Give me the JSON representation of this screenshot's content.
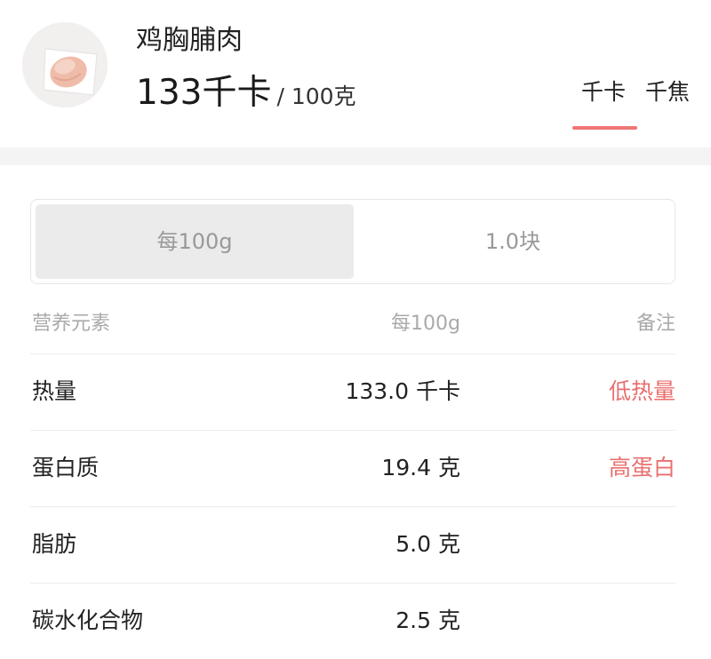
{
  "food": {
    "name": "鸡胸脯肉",
    "calories_value": "133",
    "calories_unit": "千卡",
    "per_unit": "/ 100克",
    "image_icon": "chicken-breast-photo"
  },
  "unit_tabs": {
    "items": [
      "千卡",
      "千焦"
    ],
    "active_index": 0,
    "accent_color": "#f07676"
  },
  "portion_selector": {
    "options": [
      "每100g",
      "1.0块"
    ],
    "active_index": 0
  },
  "nutrition_table": {
    "headers": {
      "name": "营养元素",
      "amount": "每100g",
      "note": "备注"
    },
    "rows": [
      {
        "name": "热量",
        "amount": "133.0 千卡",
        "note": "低热量"
      },
      {
        "name": "蛋白质",
        "amount": "19.4 克",
        "note": "高蛋白"
      },
      {
        "name": "脂肪",
        "amount": "5.0 克",
        "note": ""
      },
      {
        "name": "碳水化合物",
        "amount": "2.5 克",
        "note": ""
      }
    ],
    "note_color": "#ea6f6f"
  }
}
